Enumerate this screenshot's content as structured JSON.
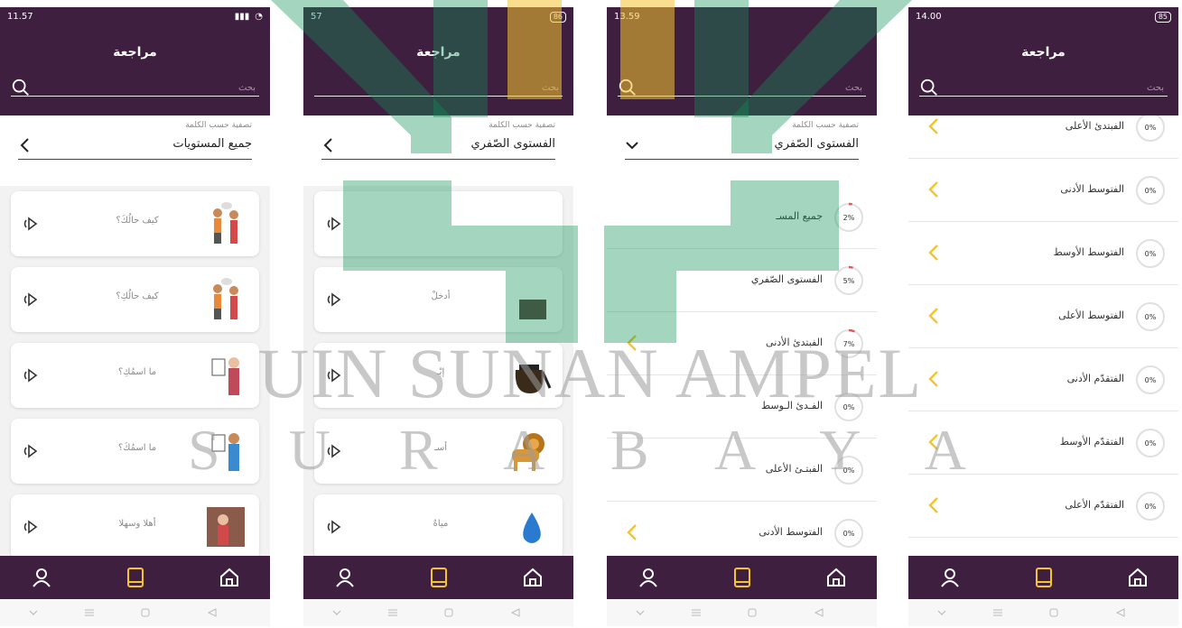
{
  "colors": {
    "header": "#3f1f3f",
    "accent": "#f4c430",
    "watermark_green": "#0f9158",
    "progress": "#e05a5a"
  },
  "common": {
    "title": "مراجعة",
    "search_placeholder": "بحث",
    "filter_label": "تصفية حسب الكلمة"
  },
  "phones": [
    {
      "status_time": "11.57",
      "filter_value": "جميع المستويات",
      "cards": [
        {
          "word": "كيف حالُكَ؟",
          "picture": "two-people-talking"
        },
        {
          "word": "كيف حالُكِ؟",
          "picture": "two-people-talking"
        },
        {
          "word": "ما اسمُكِ؟",
          "picture": "woman-with-id-card"
        },
        {
          "word": "ما اسمُكَ؟",
          "picture": "man-with-id-card"
        },
        {
          "word": "أهلا وسهلا",
          "picture": "greeting-scene"
        }
      ]
    },
    {
      "status_time": "57",
      "battery": "86",
      "filter_value": "الفستوى الصّفري",
      "cards": [
        {
          "word": "",
          "picture": ""
        },
        {
          "word": "أدخلْ",
          "picture": "door"
        },
        {
          "word": "إبْـ",
          "picture": "coffee-pot"
        },
        {
          "word": "أسـ",
          "picture": "lion"
        },
        {
          "word": "مياهٌ",
          "picture": "water-drop"
        }
      ]
    },
    {
      "status_time": "13.59",
      "filter_value": "الفستوى الصّفري",
      "levels": [
        {
          "name": "جميع المسـ",
          "pct": "2%",
          "progress": 0.02
        },
        {
          "name": "الفستوى الصّفري",
          "pct": "5%",
          "progress": 0.05
        },
        {
          "name": "الفبتدئ الأدنى",
          "pct": "7%",
          "progress": 0.07
        },
        {
          "name": "الفـدئ الـوسط",
          "pct": "0%",
          "progress": 0
        },
        {
          "name": "الفبتـئ الأعلى",
          "pct": "0%",
          "progress": 0
        },
        {
          "name": "الفتوسط الأدنى",
          "pct": "0%",
          "progress": 0
        }
      ]
    },
    {
      "status_time": "14.00",
      "battery": "85",
      "levels": [
        {
          "name": "الفبتدئ الأعلى",
          "pct": "0%",
          "progress": 0
        },
        {
          "name": "الفتوسط الأدنى",
          "pct": "0%",
          "progress": 0
        },
        {
          "name": "الفتوسط الأوسط",
          "pct": "0%",
          "progress": 0
        },
        {
          "name": "الفتوسط الأعلى",
          "pct": "0%",
          "progress": 0
        },
        {
          "name": "الفتقدّم الأدنى",
          "pct": "0%",
          "progress": 0
        },
        {
          "name": "الفتقدّم الأوسط",
          "pct": "0%",
          "progress": 0
        },
        {
          "name": "الفتقدّم الأعلى",
          "pct": "0%",
          "progress": 0
        }
      ]
    }
  ],
  "watermark": {
    "line1": "UIN SUNAN AMPEL",
    "line2": "S U R A B A Y A"
  }
}
